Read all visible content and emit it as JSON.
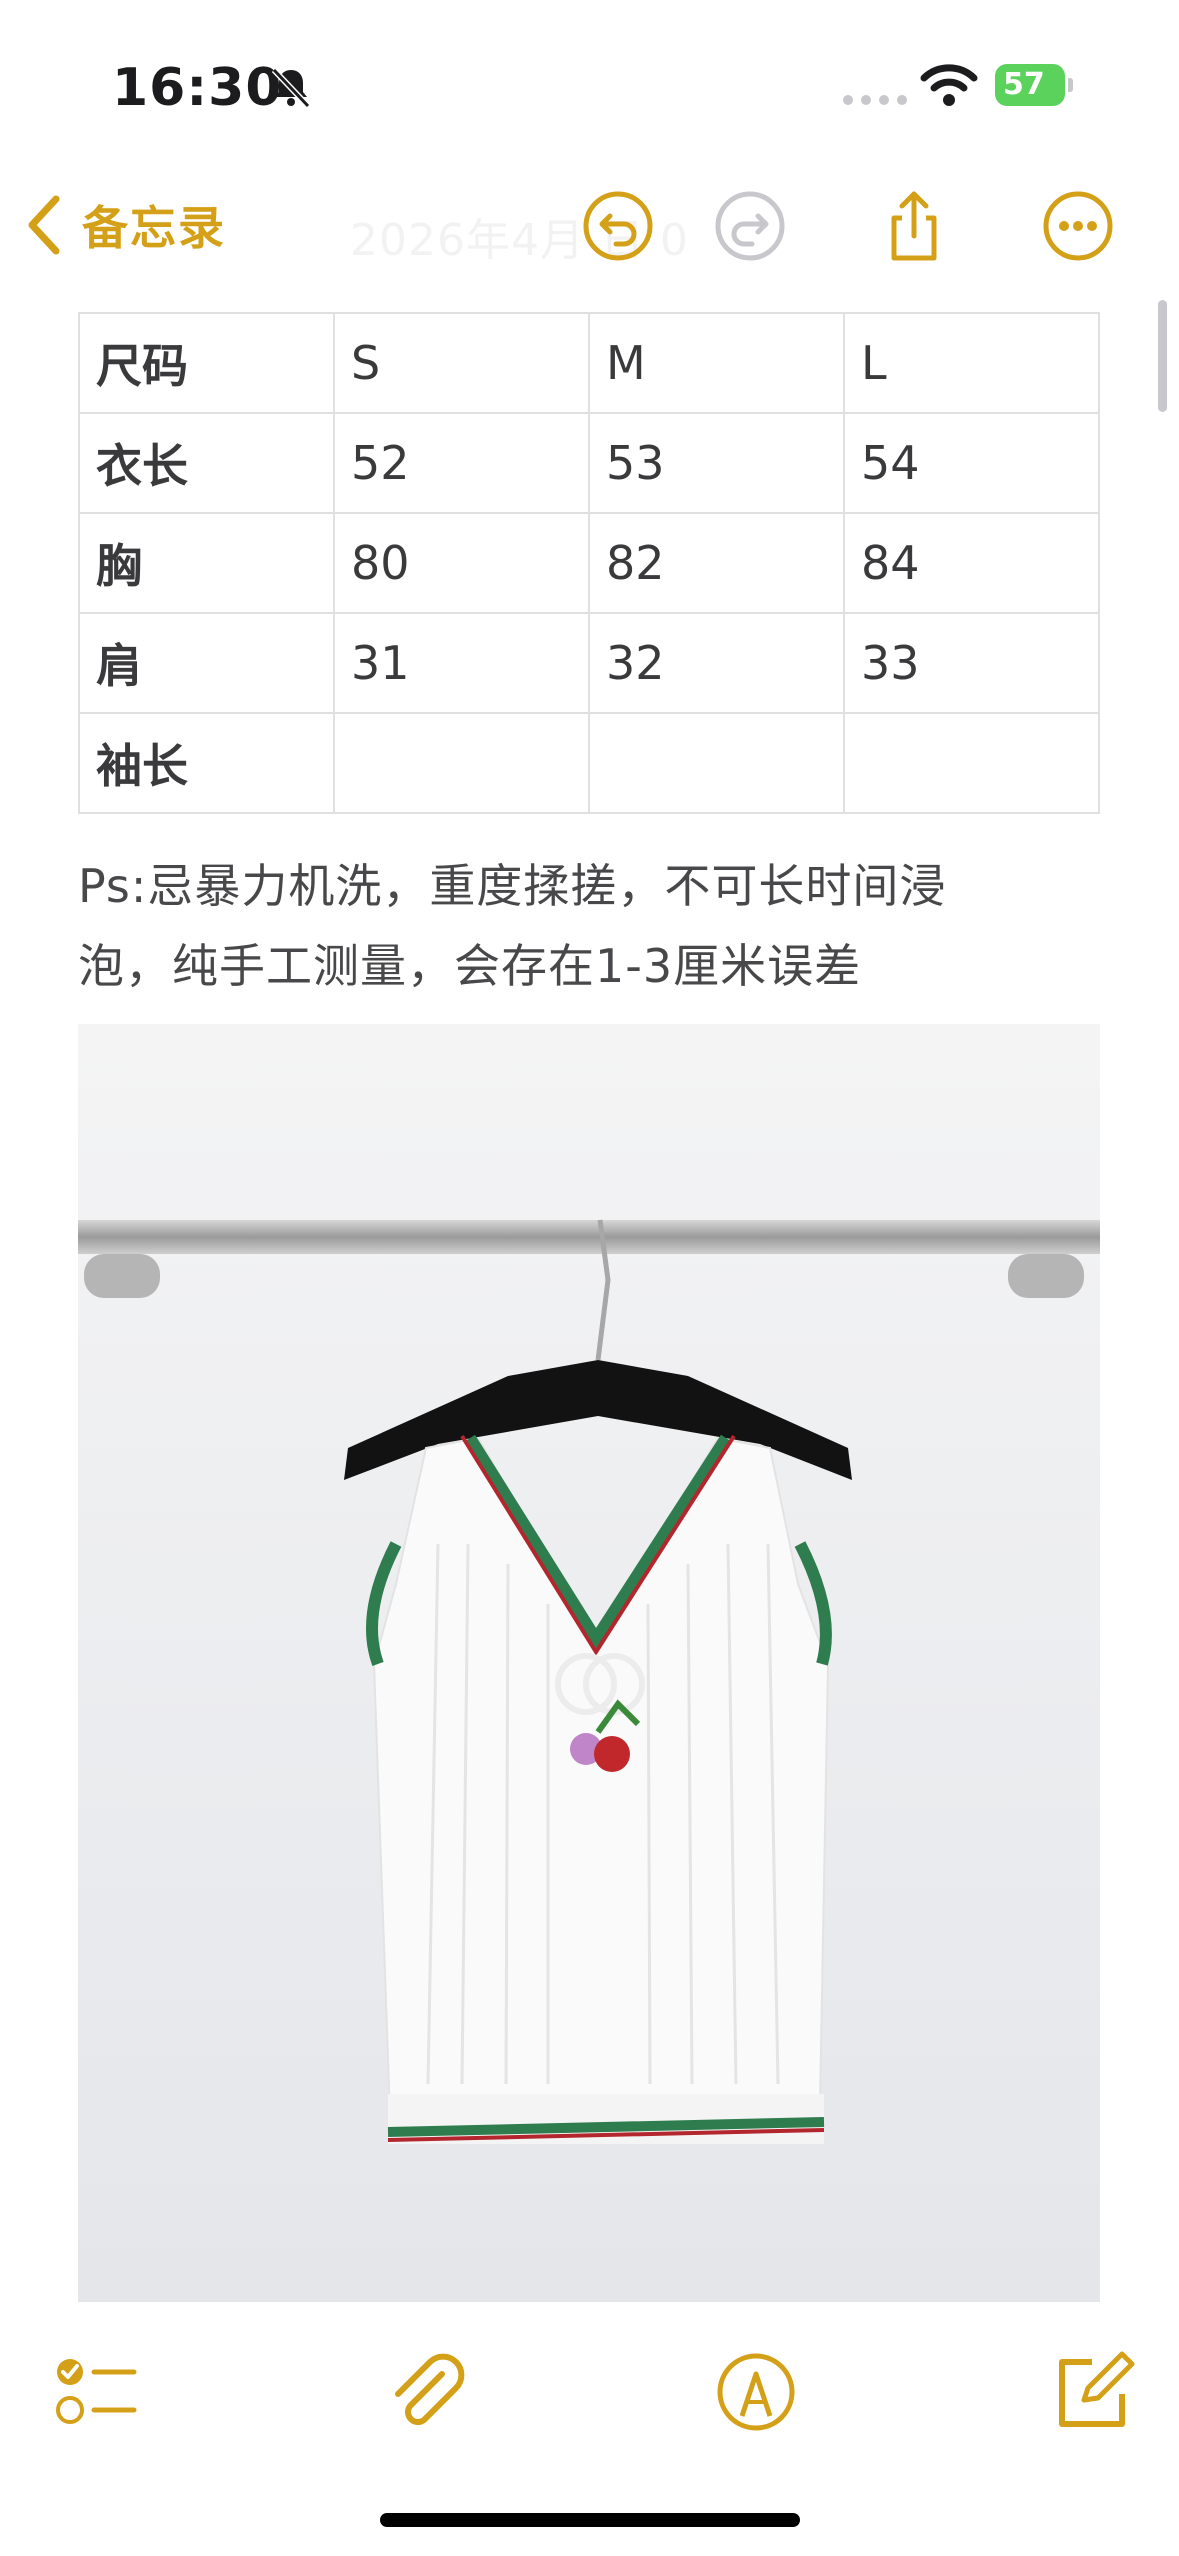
{
  "status_bar": {
    "time": "16:30",
    "battery_level": "57"
  },
  "nav": {
    "back_label": "备忘录",
    "title_faded": "2026年4月 日 0",
    "icons": [
      "undo-icon",
      "redo-icon",
      "share-icon",
      "more-icon"
    ]
  },
  "table": {
    "rows": [
      [
        "尺码",
        "S",
        "M",
        "L"
      ],
      [
        "衣长",
        "52",
        "53",
        "54"
      ],
      [
        "胸",
        "80",
        "82",
        "84"
      ],
      [
        "肩",
        "31",
        "32",
        "33"
      ],
      [
        "袖长",
        "",
        "",
        ""
      ]
    ]
  },
  "note": {
    "line1": "Ps:忌暴力机洗，重度揉搓，不可长时间浸",
    "line2": "泡，纯手工测量，会存在1-3厘米误差"
  },
  "toolbar": {
    "icons": [
      "checklist-icon",
      "attachment-icon",
      "markup-icon",
      "compose-icon"
    ]
  },
  "colors": {
    "accent": "#d4a017",
    "text": "#1c1c1e",
    "trim_green": "#2f7d4e",
    "trim_red": "#b3262d"
  }
}
